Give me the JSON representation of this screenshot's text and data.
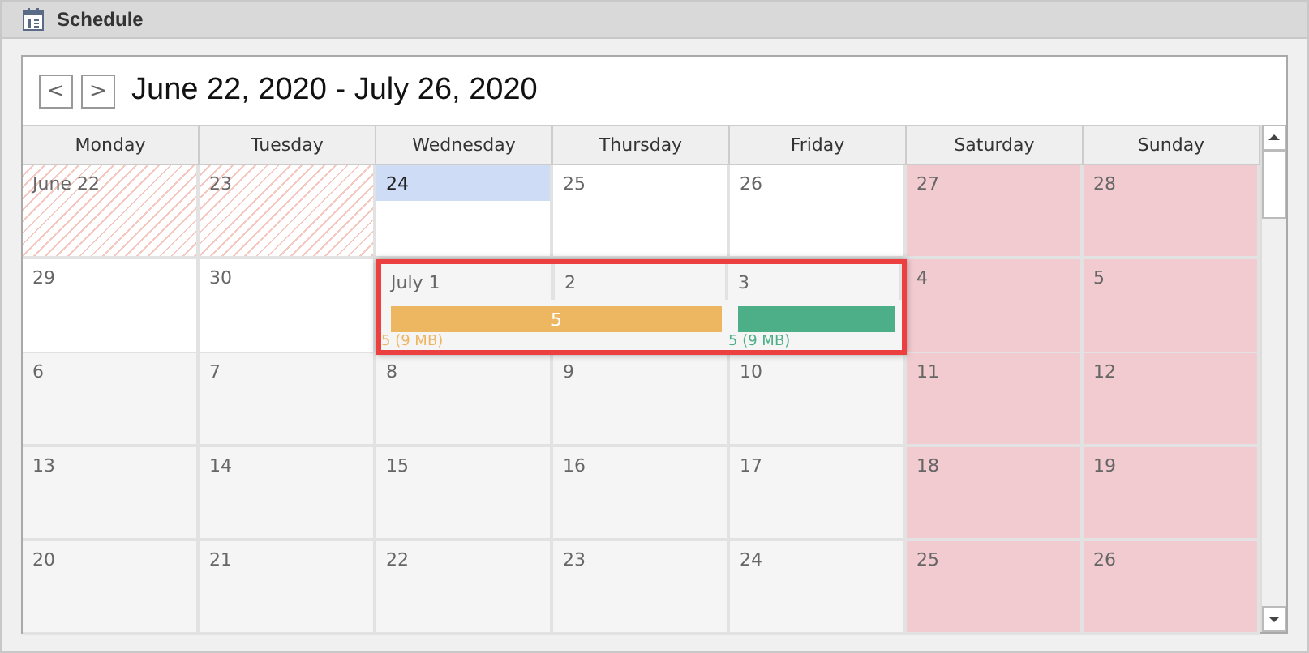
{
  "window": {
    "title": "Schedule"
  },
  "range": {
    "title": "June 22, 2020 - July 26, 2020",
    "prev": "<",
    "next": ">"
  },
  "columns": [
    "Monday",
    "Tuesday",
    "Wednesday",
    "Thursday",
    "Friday",
    "Saturday",
    "Sunday"
  ],
  "weeks": [
    {
      "cells": [
        {
          "day": "June 22",
          "kind": "hatched",
          "selected": false
        },
        {
          "day": "23",
          "kind": "hatched",
          "selected": false
        },
        {
          "day": "24",
          "kind": "plain",
          "selected": true
        },
        {
          "day": "25",
          "kind": "plain",
          "selected": false
        },
        {
          "day": "26",
          "kind": "plain",
          "selected": false
        },
        {
          "day": "27",
          "kind": "weekend",
          "selected": false
        },
        {
          "day": "28",
          "kind": "weekend",
          "selected": false
        }
      ]
    },
    {
      "cells": [
        {
          "day": "29",
          "kind": "plain",
          "selected": false,
          "highlighted": false
        },
        {
          "day": "30",
          "kind": "plain",
          "selected": false,
          "highlighted": false
        },
        {
          "day": "July 1",
          "kind": "shaded",
          "selected": false,
          "highlighted": true,
          "event": {
            "label": "5",
            "caption": "5 (9 MB)",
            "color": "#edb661"
          }
        },
        {
          "day": "2",
          "kind": "shaded",
          "selected": false,
          "continued": true,
          "highlighted": true
        },
        {
          "day": "3",
          "kind": "shaded",
          "selected": false,
          "highlighted": true,
          "event": {
            "caption": "5 (9 MB)",
            "color": "#4caf87"
          }
        },
        {
          "day": "4",
          "kind": "weekend",
          "selected": false,
          "highlighted": false
        },
        {
          "day": "5",
          "kind": "weekend",
          "selected": false,
          "highlighted": false
        }
      ]
    },
    {
      "cells": [
        {
          "day": "6",
          "kind": "shaded",
          "selected": false
        },
        {
          "day": "7",
          "kind": "shaded",
          "selected": false
        },
        {
          "day": "8",
          "kind": "shaded",
          "selected": false
        },
        {
          "day": "9",
          "kind": "shaded",
          "selected": false
        },
        {
          "day": "10",
          "kind": "shaded",
          "selected": false
        },
        {
          "day": "11",
          "kind": "weekend",
          "selected": false
        },
        {
          "day": "12",
          "kind": "weekend",
          "selected": false
        }
      ]
    },
    {
      "cells": [
        {
          "day": "13",
          "kind": "shaded",
          "selected": false
        },
        {
          "day": "14",
          "kind": "shaded",
          "selected": false
        },
        {
          "day": "15",
          "kind": "shaded",
          "selected": false
        },
        {
          "day": "16",
          "kind": "shaded",
          "selected": false
        },
        {
          "day": "17",
          "kind": "shaded",
          "selected": false
        },
        {
          "day": "18",
          "kind": "weekend",
          "selected": false
        },
        {
          "day": "19",
          "kind": "weekend",
          "selected": false
        }
      ]
    },
    {
      "cells": [
        {
          "day": "20",
          "kind": "shaded",
          "selected": false
        },
        {
          "day": "21",
          "kind": "shaded",
          "selected": false
        },
        {
          "day": "22",
          "kind": "shaded",
          "selected": false
        },
        {
          "day": "23",
          "kind": "shaded",
          "selected": false
        },
        {
          "day": "24",
          "kind": "shaded",
          "selected": false
        },
        {
          "day": "25",
          "kind": "weekend",
          "selected": false
        },
        {
          "day": "26",
          "kind": "weekend",
          "selected": false
        }
      ]
    }
  ]
}
